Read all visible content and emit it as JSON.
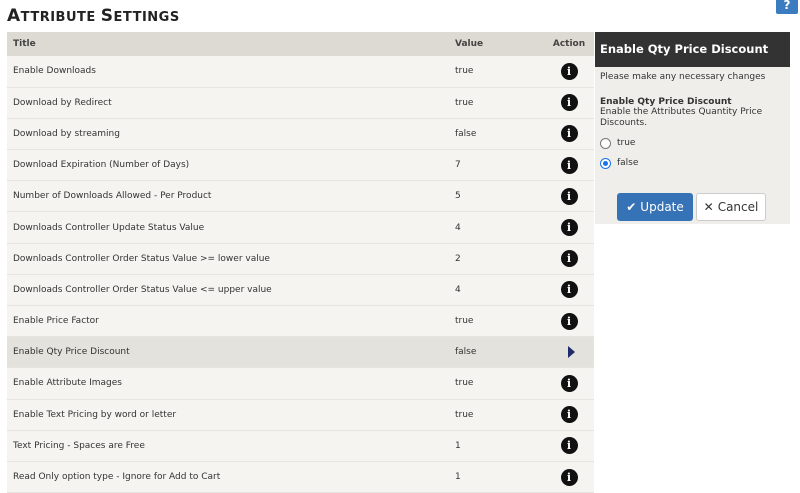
{
  "page": {
    "title_first_letter": "A",
    "title_rest_1": "TTRIBUTE ",
    "title_first_letter_2": "S",
    "title_rest_2": "ETTINGS",
    "help_label": "?"
  },
  "table": {
    "headers": {
      "title": "Title",
      "value": "Value",
      "action": "Action"
    },
    "info_glyph": "i",
    "rows": [
      {
        "title": "Enable Downloads",
        "value": "true"
      },
      {
        "title": "Download by Redirect",
        "value": "true"
      },
      {
        "title": "Download by streaming",
        "value": "false"
      },
      {
        "title": "Download Expiration (Number of Days)",
        "value": "7"
      },
      {
        "title": "Number of Downloads Allowed - Per Product",
        "value": "5"
      },
      {
        "title": "Downloads Controller Update Status Value",
        "value": "4"
      },
      {
        "title": "Downloads Controller Order Status Value >= lower value",
        "value": "2"
      },
      {
        "title": "Downloads Controller Order Status Value <= upper value",
        "value": "4"
      },
      {
        "title": "Enable Price Factor",
        "value": "true"
      },
      {
        "title": "Enable Qty Price Discount",
        "value": "false"
      },
      {
        "title": "Enable Attribute Images",
        "value": "true"
      },
      {
        "title": "Enable Text Pricing by word or letter",
        "value": "true"
      },
      {
        "title": "Text Pricing - Spaces are Free",
        "value": "1"
      },
      {
        "title": "Read Only option type - Ignore for Add to Cart",
        "value": "1"
      }
    ]
  },
  "panel": {
    "heading": "Enable Qty Price Discount",
    "intro": "Please make any necessary changes",
    "field_label": "Enable Qty Price Discount",
    "field_desc": "Enable the Attributes Quantity Price Discounts.",
    "options": [
      {
        "label": "true"
      },
      {
        "label": "false"
      }
    ],
    "update_label": "Update",
    "cancel_label": "Cancel",
    "check_glyph": "✔",
    "cancel_glyph": "✕"
  },
  "icons": {
    "info": "info-icon",
    "arrow": "caret-right-icon",
    "help": "help-icon"
  }
}
